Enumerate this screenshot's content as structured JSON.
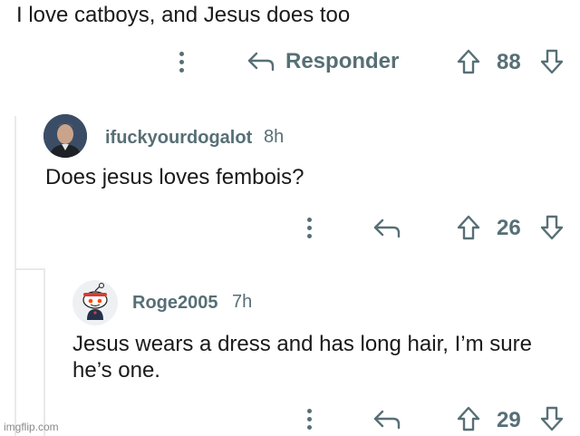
{
  "top_comment": {
    "text": "I love catboys, and Jesus does too",
    "reply_label": "Responder",
    "score": "88"
  },
  "reply1": {
    "username": "ifuckyourdogalot",
    "age": "8h",
    "text": "Does jesus loves fembois?",
    "score": "26",
    "avatar": "user-photo-avatar"
  },
  "reply2": {
    "username": "Roge2005",
    "age": "7h",
    "text_line1": "Jesus wears a dress and has long hair, I’m sure",
    "text_line2": "he’s one.",
    "score": "29",
    "avatar": "reddit-snoo-avatar"
  },
  "watermark": "imgflip.com",
  "icons": {
    "more": "kebab-icon",
    "reply": "reply-arrow-icon",
    "upvote": "upvote-arrow-icon",
    "downvote": "downvote-arrow-icon"
  },
  "colors": {
    "text": "#1a1a1b",
    "meta": "#576f76",
    "thread_line": "#e9e9e9"
  }
}
